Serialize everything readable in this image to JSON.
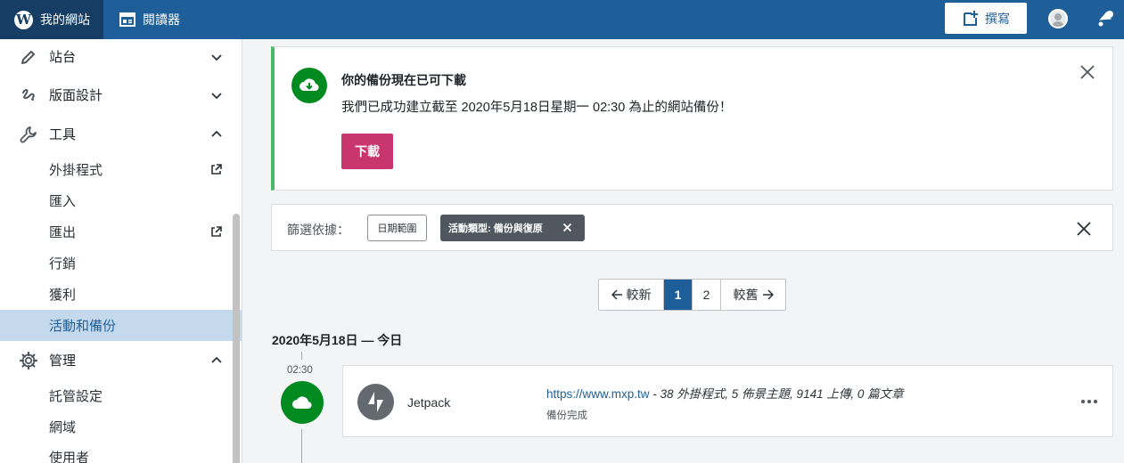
{
  "topbar": {
    "site_label": "我的網站",
    "reader_label": "閱讀器",
    "write_label": "撰寫"
  },
  "sidebar": {
    "items": [
      {
        "label": "站台",
        "icon": "pencil-icon",
        "expanded": false
      },
      {
        "label": "版面設計",
        "icon": "design-icon",
        "expanded": false
      },
      {
        "label": "工具",
        "icon": "wrench-icon",
        "expanded": true
      },
      {
        "label": "管理",
        "icon": "gear-icon",
        "expanded": true
      }
    ],
    "tools_sub": [
      {
        "label": "外掛程式",
        "external": true
      },
      {
        "label": "匯入",
        "external": false
      },
      {
        "label": "匯出",
        "external": true
      },
      {
        "label": "行銷",
        "external": false
      },
      {
        "label": "獲利",
        "external": false
      },
      {
        "label": "活動和備份",
        "external": false,
        "active": true
      }
    ],
    "manage_sub": [
      {
        "label": "託管設定"
      },
      {
        "label": "網域"
      },
      {
        "label": "使用者"
      }
    ]
  },
  "banner": {
    "title": "你的備份現在已可下載",
    "text": "我們已成功建立截至 2020年5月18日星期一 02:30 為止的網站備份！",
    "button": "下載",
    "accent": "#4ab866",
    "button_color": "#c9356e"
  },
  "filter": {
    "label": "篩選依據：",
    "date_chip": "日期範圍",
    "type_chip": "活動類型: 備份與復原"
  },
  "pagination": {
    "newer": "較新",
    "pages": [
      "1",
      "2"
    ],
    "current": "1",
    "older": "較舊"
  },
  "activity": {
    "date_heading": "2020年5月18日 — 今日",
    "time": "02:30",
    "actor": "Jetpack",
    "link": "https://www.mxp.tw",
    "summary": " - 38 外掛程式, 5 佈景主題, 9141 上傳, 0 篇文章",
    "status": "備份完成",
    "status_color": "#008a20"
  }
}
